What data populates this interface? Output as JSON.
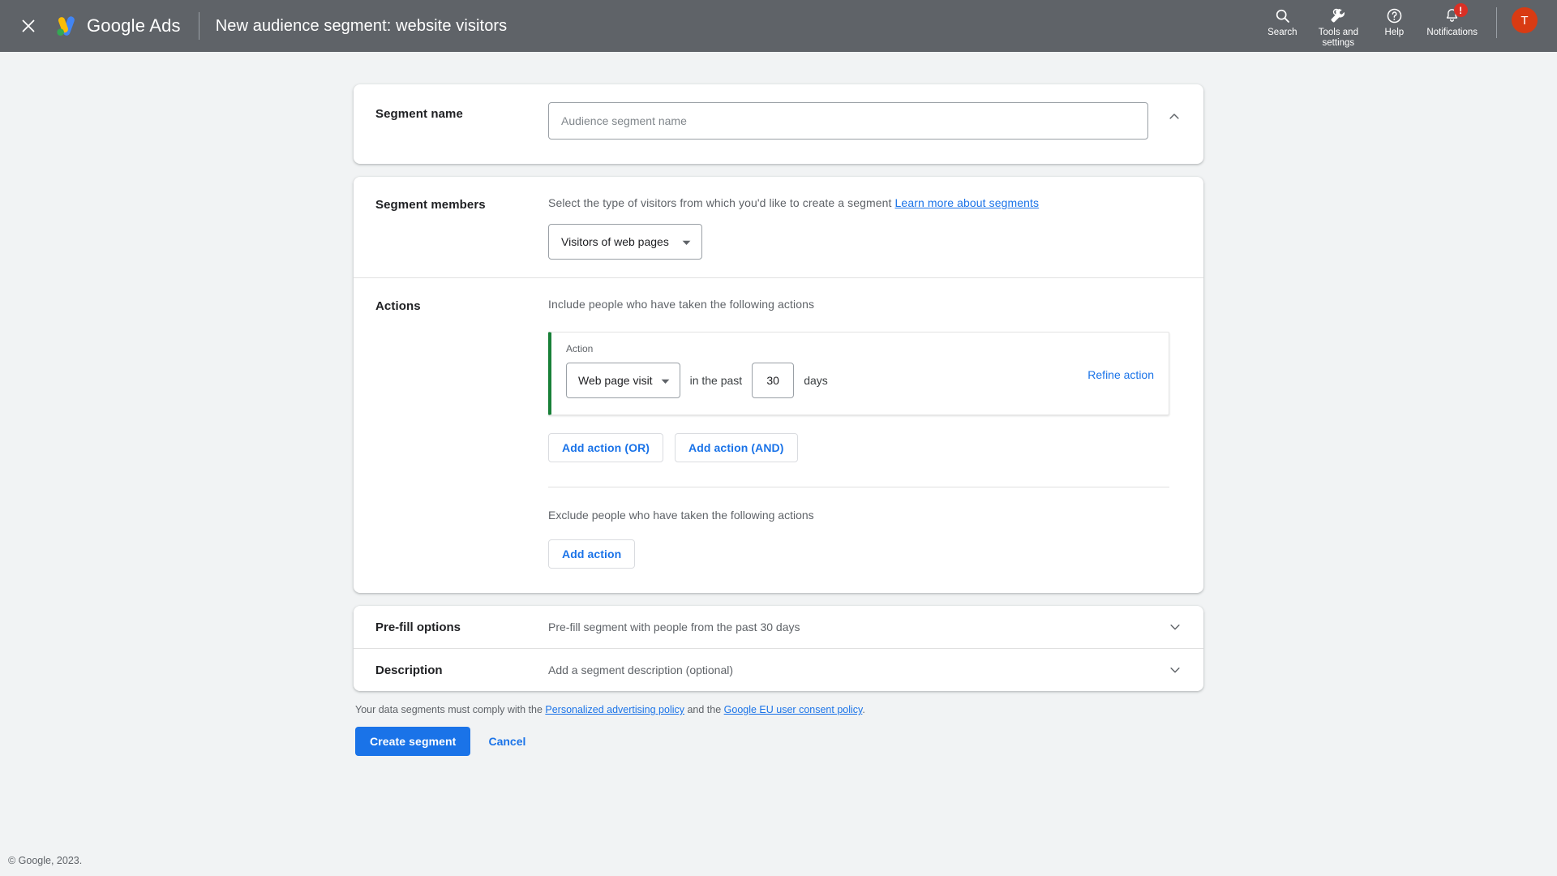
{
  "header": {
    "close_icon": "close-icon",
    "brand": "Google Ads",
    "title": "New audience segment: website visitors",
    "items": [
      {
        "label": "Search",
        "icon": "search-icon"
      },
      {
        "label": "Tools and settings",
        "icon": "wrench-icon"
      },
      {
        "label": "Help",
        "icon": "help-circle-icon"
      },
      {
        "label": "Notifications",
        "icon": "bell-icon",
        "badge": "!"
      }
    ],
    "avatar_initial": "T",
    "avatar_color": "#d93b13",
    "bar_color": "#5f6368"
  },
  "segment_name": {
    "label": "Segment name",
    "placeholder": "Audience segment name",
    "value": "",
    "collapse_icon": "chevron-up-icon"
  },
  "segment_members": {
    "label": "Segment members",
    "description": "Select the type of visitors from which you'd like to create a segment",
    "link_text": "Learn more about segments",
    "selected_type": "Visitors of web pages"
  },
  "actions": {
    "label": "Actions",
    "include_text": "Include people who have taken the following actions",
    "action_card": {
      "caption": "Action",
      "selected_action": "Web page visit",
      "between_text": "in the past",
      "days_value": "30",
      "days_unit": "days",
      "refine_label": "Refine action",
      "accent_color": "#188038"
    },
    "add_or_label": "Add action (OR)",
    "add_and_label": "Add action (AND)",
    "exclude_text": "Exclude people who have taken the following actions",
    "exclude_add_label": "Add action"
  },
  "collapsed_sections": [
    {
      "label": "Pre-fill options",
      "value": "Pre-fill segment with people from the past 30 days",
      "icon": "chevron-down-icon"
    },
    {
      "label": "Description",
      "value": "Add a segment description (optional)",
      "icon": "chevron-down-icon"
    }
  ],
  "footer": {
    "policy_prefix": "Your data segments must comply with the ",
    "policy_link_1": "Personalized advertising policy",
    "policy_middle": " and the ",
    "policy_link_2": "Google EU user consent policy",
    "policy_suffix": ".",
    "create_label": "Create segment",
    "cancel_label": "Cancel",
    "copyright": "© Google, 2023.",
    "primary_color": "#1a73e8"
  }
}
